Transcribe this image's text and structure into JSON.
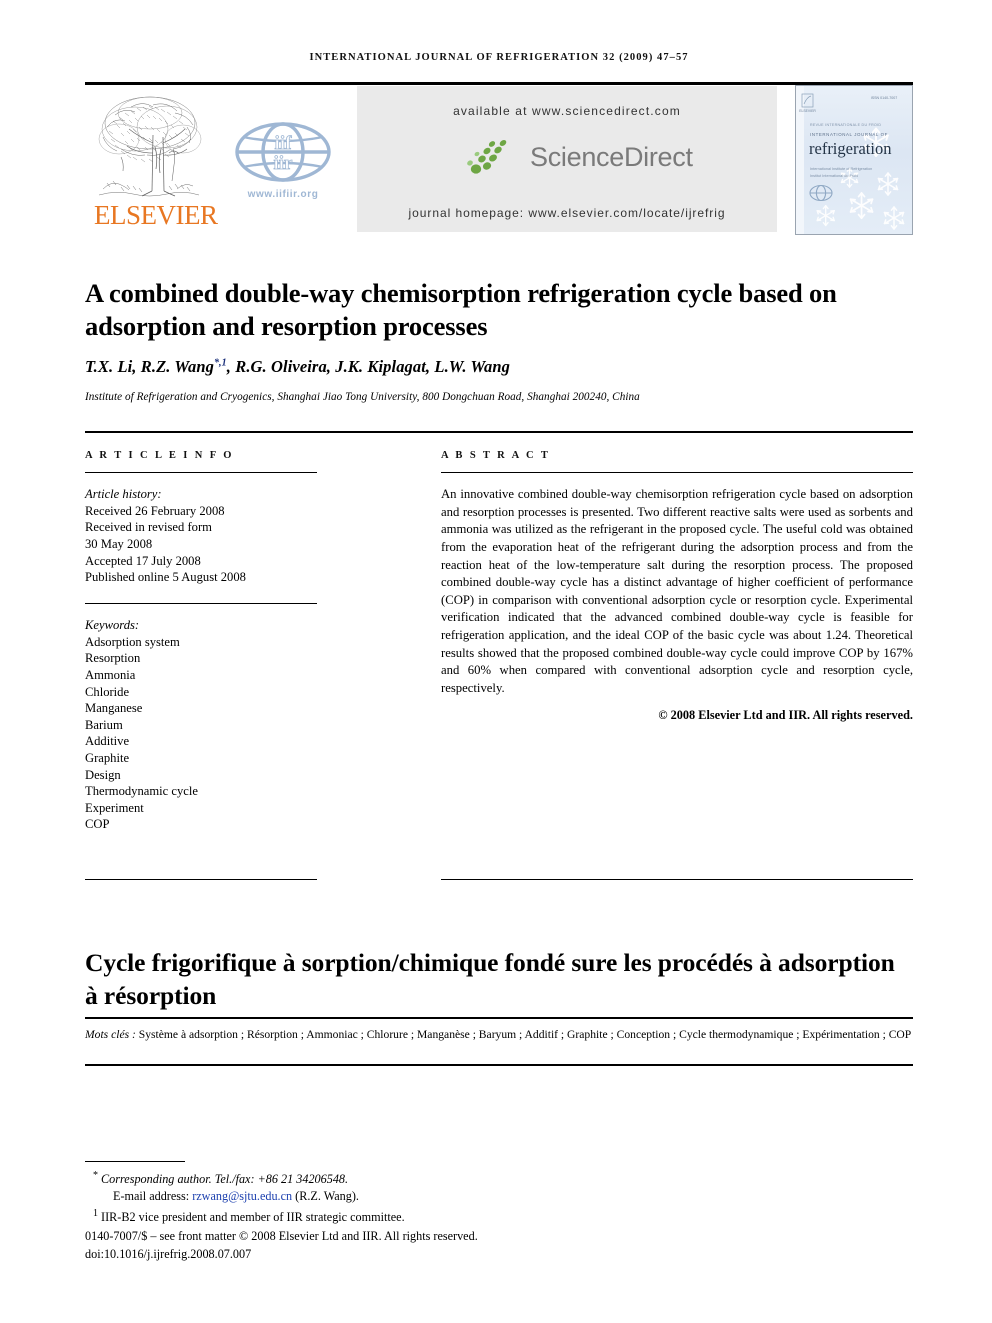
{
  "running_head": "INTERNATIONAL JOURNAL OF REFRIGERATION 32 (2009) 47–57",
  "masthead": {
    "publisher_name": "ELSEVIER",
    "iif_caption": "www.iifiir.org",
    "available_at": "available at www.sciencedirect.com",
    "sciencedirect_word": "ScienceDirect",
    "journal_homepage": "journal homepage: www.elsevier.com/locate/ijrefrig",
    "cover_journal_small": "INTERNATIONAL JOURNAL OF",
    "cover_journal_title": "refrigeration",
    "cover_subline_1": "International Institute of Refrigeration",
    "cover_subline_2": "Institut International du Froid",
    "cover_topline": "ISSN 0140-7007",
    "cover_elsevier": "ELSEVIER"
  },
  "article": {
    "title": "A combined double-way chemisorption refrigeration cycle based on adsorption and resorption processes",
    "authors_html": "T.X. Li, R.Z. Wang*,1, R.G. Oliveira, J.K. Kiplagat, L.W. Wang",
    "author_marks": "*,1",
    "authors_pre": "T.X. Li, R.Z. Wang",
    "authors_post": ", R.G. Oliveira, J.K. Kiplagat, L.W. Wang",
    "affiliation": "Institute of Refrigeration and Cryogenics, Shanghai Jiao Tong University, 800 Dongchuan Road, Shanghai 200240, China"
  },
  "article_info": {
    "heading": "A R T I C L E   I N F O",
    "history_label": "Article history:",
    "history": [
      "Received 26 February 2008",
      "Received in revised form",
      "30 May 2008",
      "Accepted 17 July 2008",
      "Published online 5 August 2008"
    ],
    "keywords_label": "Keywords:",
    "keywords": [
      "Adsorption system",
      "Resorption",
      "Ammonia",
      "Chloride",
      "Manganese",
      "Barium",
      "Additive",
      "Graphite",
      "Design",
      "Thermodynamic cycle",
      "Experiment",
      "COP"
    ]
  },
  "abstract": {
    "heading": "A B S T R A C T",
    "text": "An innovative combined double-way chemisorption refrigeration cycle based on adsorption and resorption processes is presented. Two different reactive salts were used as sorbents and ammonia was utilized as the refrigerant in the proposed cycle. The useful cold was obtained from the evaporation heat of the refrigerant during the adsorption process and from the reaction heat of the low-temperature salt during the resorption process. The proposed combined double-way cycle has a distinct advantage of higher coefficient of performance (COP) in comparison with conventional adsorption cycle or resorption cycle. Experimental verification indicated that the advanced combined double-way cycle is feasible for refrigeration application, and the ideal COP of the basic cycle was about 1.24. Theoretical results showed that the proposed combined double-way cycle could improve COP by 167% and 60% when compared with conventional adsorption cycle and resorption cycle, respectively.",
    "copyright": "© 2008 Elsevier Ltd and IIR. All rights reserved."
  },
  "french": {
    "title": "Cycle frigorifique à sorption/chimique fondé sure les procédés à adsorption à résorption",
    "keywords_label": "Mots clés : ",
    "keywords_text": "Système à adsorption ; Résorption ; Ammoniac ; Chlorure ; Manganèse ; Baryum ; Additif ; Graphite ; Conception ; Cycle thermodynamique ; Expérimentation ; COP"
  },
  "footnotes": {
    "corresponding_mark": "*",
    "corresponding_text": "Corresponding author. Tel./fax: +86 21 34206548.",
    "email_label": "E-mail address: ",
    "email": "rzwang@sjtu.edu.cn",
    "email_suffix": " (R.Z. Wang).",
    "note_mark": "1",
    "note_text": "IIR-B2 vice president and member of IIR strategic committee.",
    "front_matter": "0140-7007/$ – see front matter © 2008 Elsevier Ltd and IIR. All rights reserved.",
    "doi": "doi:10.1016/j.ijrefrig.2008.07.007"
  },
  "colors": {
    "elsevier_orange": "#E87722",
    "iif_blue": "#9FB7D4",
    "sciencedirect_grey": "#7A7A7A",
    "sciencedirect_green": "#6EA644",
    "link_blue": "#1b3fae",
    "panel_grey": "#EAEAEA"
  }
}
